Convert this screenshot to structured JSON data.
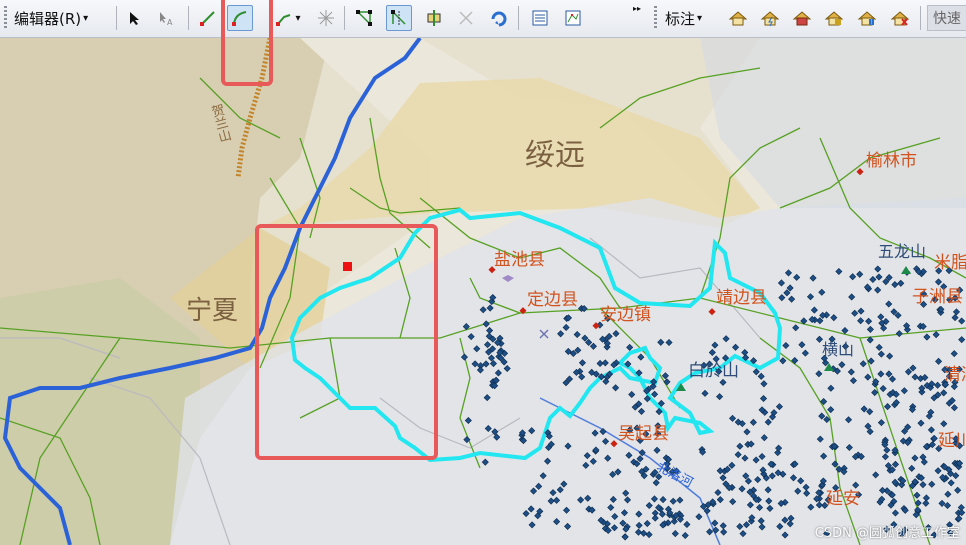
{
  "toolbar": {
    "editor_menu": "编辑器(R)",
    "label_menu": "标注",
    "quick_label": "快速",
    "caret": "▾"
  },
  "map": {
    "regions": {
      "suiyuan": "绥远",
      "ningxia": "宁夏",
      "helanshan": "贺兰山"
    },
    "cities": {
      "yulin": "榆林市",
      "yanchi": "盐池县",
      "dingbian": "定边县",
      "anbian": "安边镇",
      "jingbian": "靖边县",
      "baiyu": "白於山",
      "wuqi": "吴起县",
      "luohe": "北洛河",
      "henshan": "横山",
      "wubu": "五龙山",
      "mizhi": "米脂",
      "zizhou": "子洲县",
      "qingjian": "清涧",
      "yanchuan": "延川",
      "yanan": "延安"
    },
    "colors": {
      "label": "#d2531d",
      "region": "#7a6040",
      "boundary": "#22e6f0",
      "highlight": "#e8595a",
      "river": "#2b62d8",
      "road": "#57a124",
      "point": "#1d4f86"
    }
  },
  "watermark": "CSDN @圆弧创意工作室"
}
